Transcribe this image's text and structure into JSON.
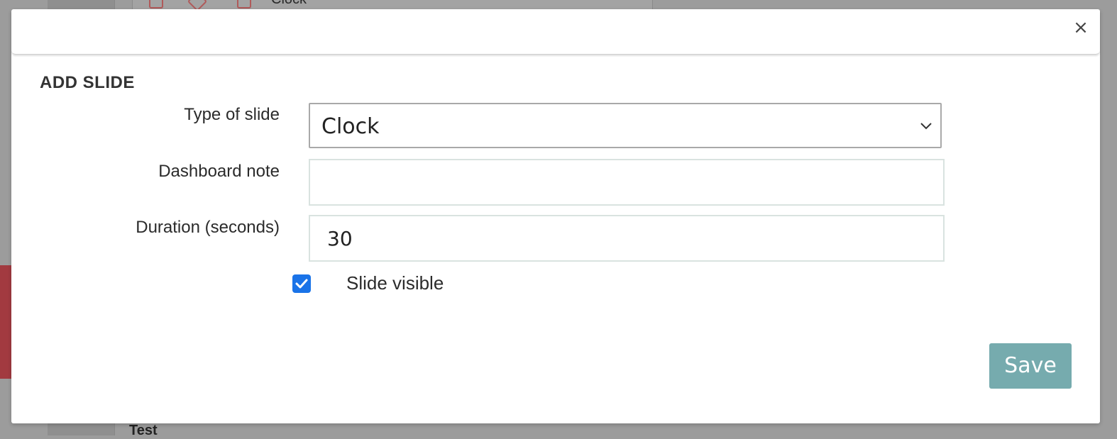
{
  "background": {
    "row_text": "Clock",
    "bottom_text": "Test",
    "accent_red": "#a23a40"
  },
  "modal": {
    "close_glyph": "×",
    "title": "ADD SLIDE",
    "fields": {
      "type_label": "Type of slide",
      "type_value": "Clock",
      "note_label": "Dashboard note",
      "note_value": "",
      "duration_label": "Duration (seconds)",
      "duration_value": "30"
    },
    "visible": {
      "label": "Slide visible",
      "checked": true
    },
    "save_label": "Save",
    "colors": {
      "save_button": "#76abae",
      "checkbox": "#1a73e8"
    },
    "icons": {
      "close": "close-icon",
      "select": "chevron-down-icon",
      "checkbox": "checkmark-icon"
    }
  }
}
